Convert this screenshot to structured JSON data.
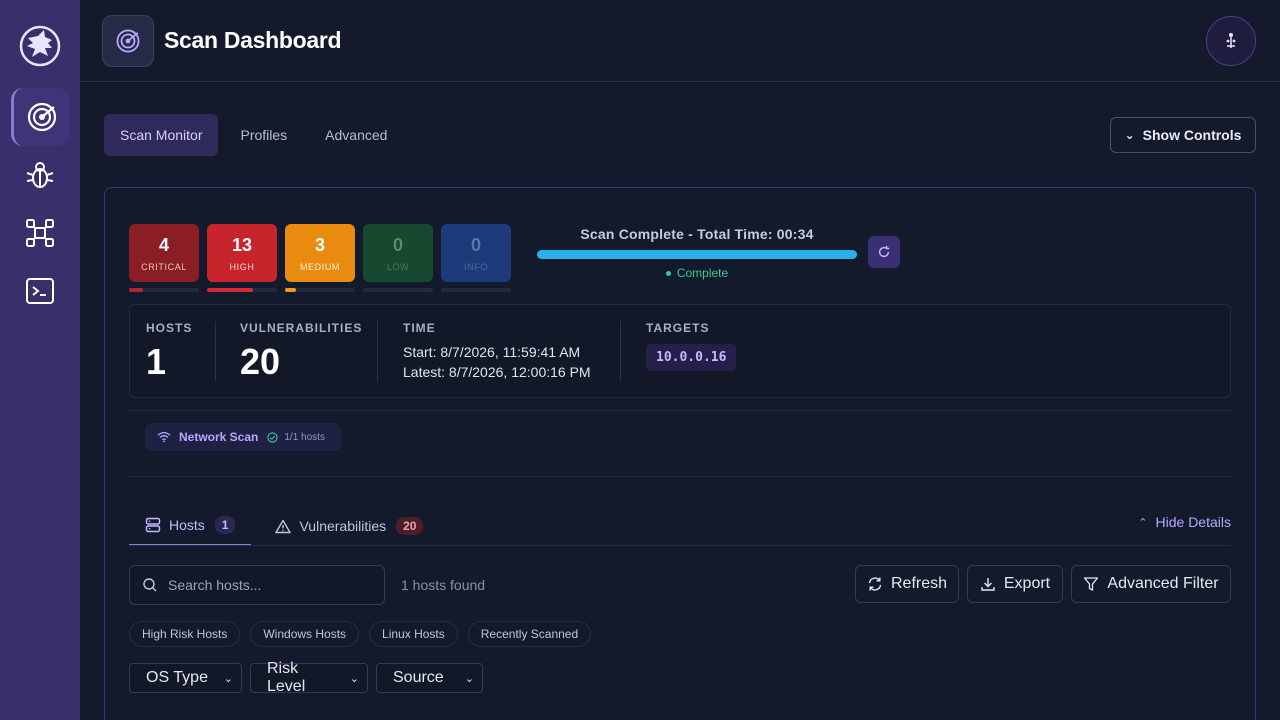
{
  "header": {
    "title": "Scan Dashboard"
  },
  "main_tabs": [
    {
      "label": "Scan Monitor",
      "active": true
    },
    {
      "label": "Profiles",
      "active": false
    },
    {
      "label": "Advanced",
      "active": false
    }
  ],
  "show_controls_label": "Show Controls",
  "severity": [
    {
      "count": "4",
      "label": "CRITICAL",
      "bg": "#8b1d24",
      "fg": "#ffffff",
      "lbl": "#f0c2c6",
      "bar": "#b3262f",
      "fill_fraction": 0.2
    },
    {
      "count": "13",
      "label": "HIGH",
      "bg": "#c8242c",
      "fg": "#ffffff",
      "lbl": "#ffd4d6",
      "bar": "#d92832",
      "fill_fraction": 0.65
    },
    {
      "count": "3",
      "label": "MEDIUM",
      "bg": "#e98b0e",
      "fg": "#ffffff",
      "lbl": "#fff1dc",
      "bar": "#f29a1a",
      "fill_fraction": 0.15
    },
    {
      "count": "0",
      "label": "LOW",
      "bg": "#16492f",
      "fg": "#5f8a72",
      "lbl": "#4c7560",
      "bar": "#1f6a45",
      "fill_fraction": 0
    },
    {
      "count": "0",
      "label": "INFO",
      "bg": "#1d3a7a",
      "fg": "#5c76ad",
      "lbl": "#4e6799",
      "bar": "#2d56b2",
      "fill_fraction": 0
    }
  ],
  "progress": {
    "title": "Scan Complete - Total Time: 00:34",
    "status": "Complete",
    "fraction": 1.0
  },
  "stats": {
    "hosts_label": "HOSTS",
    "hosts_value": "1",
    "vulns_label": "VULNERABILITIES",
    "vulns_value": "20",
    "time_label": "TIME",
    "start": "Start: 8/7/2026, 11:59:41 AM",
    "latest": "Latest: 8/7/2026, 12:00:16 PM",
    "targets_label": "TARGETS",
    "target": "10.0.0.16"
  },
  "network_scan": {
    "label": "Network Scan",
    "hosts": "1/1 hosts"
  },
  "sub_tabs": [
    {
      "label": "Hosts",
      "badge": "1",
      "active": true
    },
    {
      "label": "Vulnerabilities",
      "badge": "20",
      "active": false
    }
  ],
  "hide_details_label": "Hide Details",
  "search": {
    "placeholder": "Search hosts...",
    "value": ""
  },
  "hosts_found": "1 hosts found",
  "buttons": {
    "refresh": "Refresh",
    "export": "Export",
    "advanced_filter": "Advanced Filter"
  },
  "quick_filters": [
    "High Risk Hosts",
    "Windows Hosts",
    "Linux Hosts",
    "Recently Scanned"
  ],
  "selects": [
    "OS Type",
    "Risk Level",
    "Source"
  ]
}
